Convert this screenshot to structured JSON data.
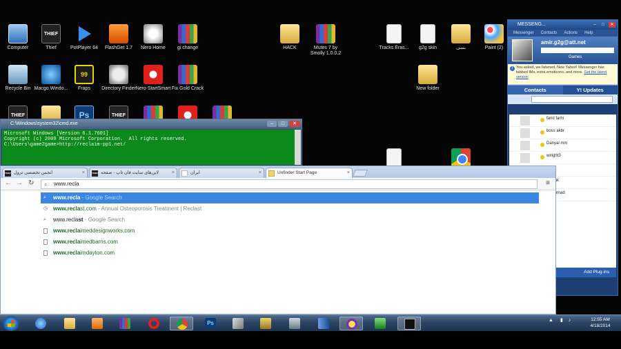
{
  "desktop": {
    "icons": [
      {
        "label": "Computer"
      },
      {
        "label": "Thief"
      },
      {
        "label": "PotPlayer 64"
      },
      {
        "label": "FlashGet 1.7"
      },
      {
        "label": "Nero Home"
      },
      {
        "label": "gi change"
      },
      {
        "label": "HACK"
      },
      {
        "label": "Mutes 7 by Smolly 1.0.0.2"
      },
      {
        "label": "Tracks Eras..."
      },
      {
        "label": "g2g skin"
      },
      {
        "label": "بسی"
      },
      {
        "label": "Paint (2)"
      },
      {
        "label": "Recycle Bin"
      },
      {
        "label": "Macgo Windo..."
      },
      {
        "label": "Fraps"
      },
      {
        "label": "Directory Finder"
      },
      {
        "label": "Nero StartSmart"
      },
      {
        "label": "Fix Gold Crack"
      },
      {
        "label": "New folder"
      }
    ],
    "thief_icon_text": "THIEF",
    "fraps_icon_text": "99",
    "ps_icon_text": "Ps"
  },
  "cmd": {
    "title": "C:\\Windows\\system32\\cmd.exe",
    "lines": [
      "Microsoft Windows [Version 6.1.7601]",
      "Copyright (c) 2009 Microsoft Corporation.  All rights reserved.",
      "",
      "C:\\Users\\game2game>http://reclaim-pp1.net/"
    ]
  },
  "messenger": {
    "title": "MESSENG...",
    "menu": [
      "Messenger",
      "Contacts",
      "Actions",
      "Help"
    ],
    "username": "amir.g2g@att.net",
    "games_label": "Games",
    "notice": "You asked, we listened. New Yahoo! Messenger has tabbed IMs, extra emoticons, and more.",
    "notice_link": "Get the latest version",
    "tabs": [
      "Contacts",
      "Y! Updates"
    ],
    "contacts": [
      {
        "name": "farid farhi"
      },
      {
        "name": "boss akbr"
      },
      {
        "name": "Danyal mm"
      },
      {
        "name": "wiright3"
      },
      {
        "name": "ackal"
      },
      {
        "name": "amonk"
      },
      {
        "name": "ohammad"
      }
    ],
    "add_plugins": "Add Plug-ins"
  },
  "browser": {
    "tabs": [
      {
        "label": "انجمن تخصصی ترول",
        "active": false
      },
      {
        "label": "لاین‌های سایت فان تاپ - صفحه",
        "active": false
      },
      {
        "label": "ایران",
        "active": false
      },
      {
        "label": "Unfinder Start Page",
        "active": true
      }
    ],
    "address_value": "www.recla",
    "suggestions": [
      {
        "icon": "search",
        "match": "www.recla",
        "rest": "",
        "meta": " - Google Search",
        "selected": true
      },
      {
        "icon": "history",
        "match": "www.recla",
        "rest": "st.com",
        "meta": " - Annual Osteoporosis Treatment | Reclast",
        "selected": false
      },
      {
        "icon": "search",
        "match": "www.recla",
        "rest": "st",
        "meta": " - Google Search",
        "selected": false
      },
      {
        "icon": "page",
        "match": "www.recla",
        "rest": "imeddesignworks.com",
        "meta": "",
        "selected": false
      },
      {
        "icon": "page",
        "match": "www.recla",
        "rest": "imedbarns.com",
        "meta": "",
        "selected": false
      },
      {
        "icon": "page",
        "match": "www.recla",
        "rest": "imdayton.com",
        "meta": "",
        "selected": false
      }
    ]
  },
  "taskbar": {
    "clock_time": "12:55 AM",
    "clock_date": "4/18/2014",
    "ps_label": "Ps"
  },
  "colors": {
    "cmd_bg": "#0b8a1b",
    "selected_suggestion": "#3b86e0",
    "messenger_blue": "#1e3f74",
    "taskbar": "#2d4566"
  }
}
